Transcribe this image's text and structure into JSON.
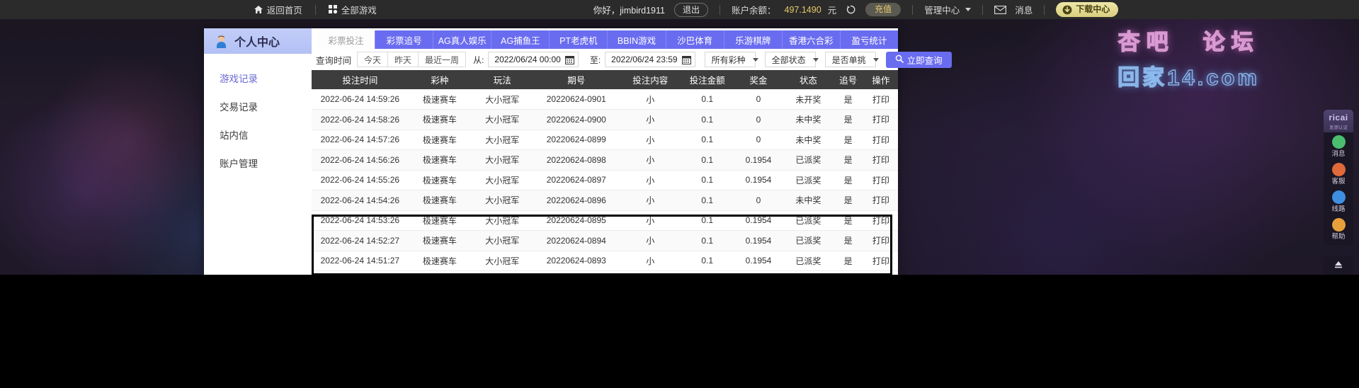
{
  "topbar": {
    "home_label": "返回首页",
    "home_icon": "home-icon",
    "all_games_label": "全部游戏",
    "all_games_icon": "grid-icon",
    "greeting": "你好，jimbird1911",
    "logout_label": "退出",
    "balance_label": "账户余额：",
    "balance_value": "497.1490",
    "currency_unit": "元",
    "refresh_icon": "refresh-icon",
    "recharge_label": "充值",
    "admin_center_label": "管理中心",
    "admin_caret_icon": "chevron-down-icon",
    "message_label": "消息",
    "message_icon": "envelope-icon",
    "download_label": "下载中心",
    "download_icon": "download-arrow-icon"
  },
  "watermark": {
    "line1": "杏吧　论坛",
    "line2": "回家14.com"
  },
  "sidebar": {
    "title": "个人中心",
    "avatar_icon": "user-avatar-icon",
    "items": [
      {
        "label": "游戏记录",
        "active": true
      },
      {
        "label": "交易记录",
        "active": false
      },
      {
        "label": "站内信",
        "active": false
      },
      {
        "label": "账户管理",
        "active": false
      }
    ]
  },
  "tabs": [
    {
      "label": "彩票投注",
      "active": true
    },
    {
      "label": "彩票追号",
      "active": false
    },
    {
      "label": "AG真人娱乐",
      "active": false
    },
    {
      "label": "AG捕鱼王",
      "active": false
    },
    {
      "label": "PT老虎机",
      "active": false
    },
    {
      "label": "BBIN游戏",
      "active": false
    },
    {
      "label": "沙巴体育",
      "active": false
    },
    {
      "label": "乐游棋牌",
      "active": false
    },
    {
      "label": "香港六合彩",
      "active": false
    },
    {
      "label": "盈亏统计",
      "active": false
    }
  ],
  "filters": {
    "query_time_label": "查询时间",
    "quick_buttons": [
      "今天",
      "昨天",
      "最近一周"
    ],
    "from_label": "从:",
    "from_value": "2022/06/24 00:00",
    "to_label": "至:",
    "to_value": "2022/06/24 23:59",
    "calendar_icon": "calendar-icon",
    "lottery_select": "所有彩种",
    "status_select": "全部状态",
    "chase_select": "是否单挑",
    "select_caret_icon": "caret-down-icon",
    "search_button_label": "立即查询",
    "search_icon": "magnifier-icon"
  },
  "table": {
    "columns": [
      "投注时间",
      "彩种",
      "玩法",
      "期号",
      "投注内容",
      "投注金额",
      "奖金",
      "状态",
      "追号",
      "操作"
    ],
    "rows": [
      {
        "time": "2022-06-24 14:59:26",
        "game": "极速赛车",
        "play": "大小冠军",
        "issue": "20220624-0901",
        "content": "小",
        "amount": "0.1",
        "prize": "0",
        "status": "未开奖",
        "chase": "是",
        "action": "打印",
        "won": false
      },
      {
        "time": "2022-06-24 14:58:26",
        "game": "极速赛车",
        "play": "大小冠军",
        "issue": "20220624-0900",
        "content": "小",
        "amount": "0.1",
        "prize": "0",
        "status": "未中奖",
        "chase": "是",
        "action": "打印",
        "won": false
      },
      {
        "time": "2022-06-24 14:57:26",
        "game": "极速赛车",
        "play": "大小冠军",
        "issue": "20220624-0899",
        "content": "小",
        "amount": "0.1",
        "prize": "0",
        "status": "未中奖",
        "chase": "是",
        "action": "打印",
        "won": false
      },
      {
        "time": "2022-06-24 14:56:26",
        "game": "极速赛车",
        "play": "大小冠军",
        "issue": "20220624-0898",
        "content": "小",
        "amount": "0.1",
        "prize": "0.1954",
        "status": "已派奖",
        "chase": "是",
        "action": "打印",
        "won": true
      },
      {
        "time": "2022-06-24 14:55:26",
        "game": "极速赛车",
        "play": "大小冠军",
        "issue": "20220624-0897",
        "content": "小",
        "amount": "0.1",
        "prize": "0.1954",
        "status": "已派奖",
        "chase": "是",
        "action": "打印",
        "won": true
      },
      {
        "time": "2022-06-24 14:54:26",
        "game": "极速赛车",
        "play": "大小冠军",
        "issue": "20220624-0896",
        "content": "小",
        "amount": "0.1",
        "prize": "0",
        "status": "未中奖",
        "chase": "是",
        "action": "打印",
        "won": false
      },
      {
        "time": "2022-06-24 14:53:26",
        "game": "极速赛车",
        "play": "大小冠军",
        "issue": "20220624-0895",
        "content": "小",
        "amount": "0.1",
        "prize": "0.1954",
        "status": "已派奖",
        "chase": "是",
        "action": "打印",
        "won": true
      },
      {
        "time": "2022-06-24 14:52:27",
        "game": "极速赛车",
        "play": "大小冠军",
        "issue": "20220624-0894",
        "content": "小",
        "amount": "0.1",
        "prize": "0.1954",
        "status": "已派奖",
        "chase": "是",
        "action": "打印",
        "won": true
      },
      {
        "time": "2022-06-24 14:51:27",
        "game": "极速赛车",
        "play": "大小冠军",
        "issue": "20220624-0893",
        "content": "小",
        "amount": "0.1",
        "prize": "0.1954",
        "status": "已派奖",
        "chase": "是",
        "action": "打印",
        "won": true
      }
    ]
  },
  "dock": {
    "logo_title": "ricai",
    "logo_sub": "发源认证",
    "items": [
      {
        "label": "消息",
        "icon": "chat-icon",
        "color": "#4bbd6e"
      },
      {
        "label": "客服",
        "icon": "headset-icon",
        "color": "#e06a3a"
      },
      {
        "label": "线路",
        "icon": "globe-icon",
        "color": "#3f8fe0"
      },
      {
        "label": "帮助",
        "icon": "question-icon",
        "color": "#e8a13a"
      }
    ],
    "back_to_top_icon": "arrow-up-icon"
  },
  "colors": {
    "accent": "#6a6cf0",
    "tab_active_bg": "#fdfdfd",
    "header_bg": "#3d3d3d",
    "win_red": "#e03b2f",
    "gold": "#e8c96a"
  }
}
